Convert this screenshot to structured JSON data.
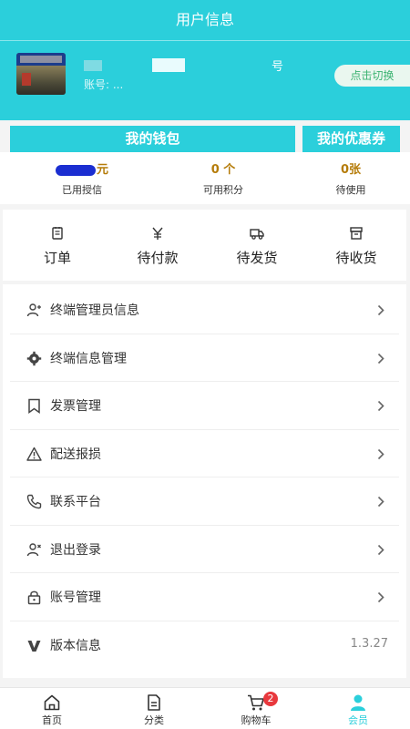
{
  "header": {
    "title": "用户信息",
    "name_suffix": "号",
    "account_prefix": "账号: ...",
    "switch_label": "点击切换"
  },
  "wallet": {
    "wallet_label": "我的钱包",
    "coupon_label": "我的优惠券",
    "stats": [
      {
        "value": "元",
        "label": "已用授信"
      },
      {
        "value": "0 个",
        "label": "可用积分"
      },
      {
        "value": "0张",
        "label": "待使用"
      }
    ]
  },
  "orders": [
    {
      "icon": "order-icon",
      "label": "订单"
    },
    {
      "icon": "yen-icon",
      "label": "待付款"
    },
    {
      "icon": "truck-icon",
      "label": "待发货"
    },
    {
      "icon": "box-icon",
      "label": "待收货"
    }
  ],
  "menu": [
    {
      "icon": "user-plus-icon",
      "label": "终端管理员信息"
    },
    {
      "icon": "gear-icon",
      "label": "终端信息管理"
    },
    {
      "icon": "bookmark-icon",
      "label": "发票管理"
    },
    {
      "icon": "warning-icon",
      "label": "配送报损"
    },
    {
      "icon": "phone-icon",
      "label": "联系平台"
    },
    {
      "icon": "user-x-icon",
      "label": "退出登录"
    },
    {
      "icon": "lock-icon",
      "label": "账号管理"
    },
    {
      "icon": "version-icon",
      "label": "版本信息",
      "value": "1.3.27"
    }
  ],
  "tabbar": {
    "items": [
      {
        "icon": "home-icon",
        "label": "首页"
      },
      {
        "icon": "category-icon",
        "label": "分类"
      },
      {
        "icon": "cart-icon",
        "label": "购物车",
        "badge": "2"
      },
      {
        "icon": "member-icon",
        "label": "会员"
      }
    ],
    "active_color": "#2bcfdb"
  },
  "colors": {
    "accent": "#2bcfdb",
    "stat_value": "#b57c0a",
    "badge": "#e8383d",
    "switch_text": "#3cb371"
  }
}
